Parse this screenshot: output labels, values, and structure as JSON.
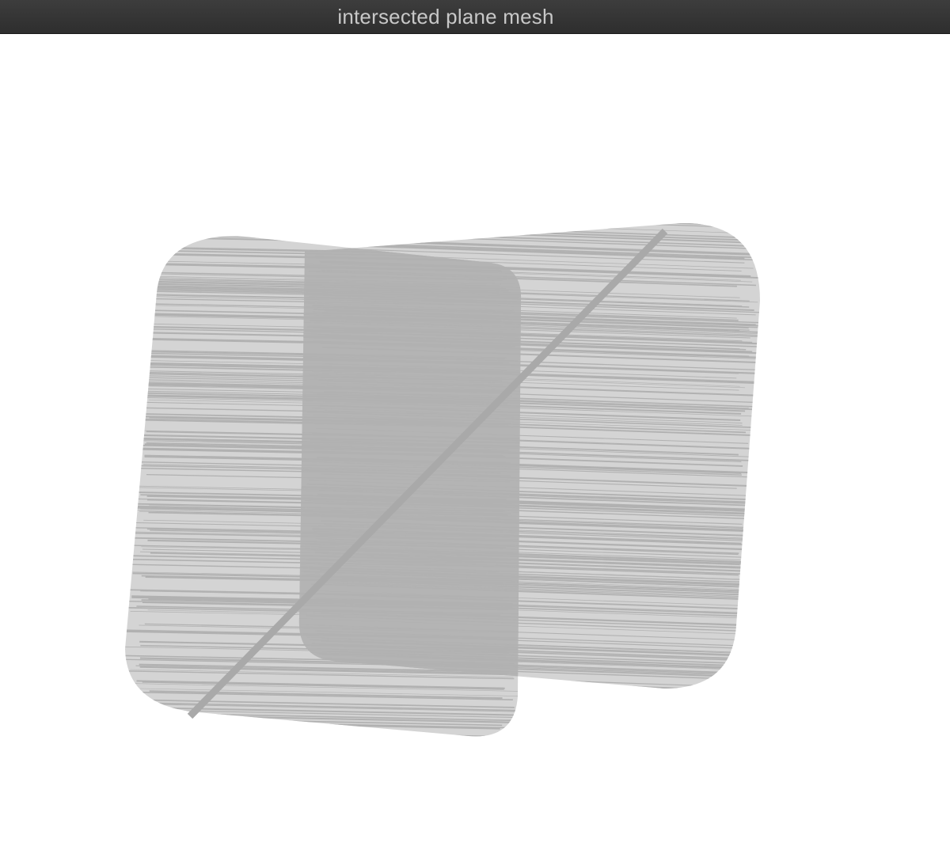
{
  "window": {
    "title": "intersected plane mesh"
  },
  "scene": {
    "mesh_color": "#b1b1b1",
    "background_color": "#ffffff",
    "titlebar_color": "#353535"
  }
}
